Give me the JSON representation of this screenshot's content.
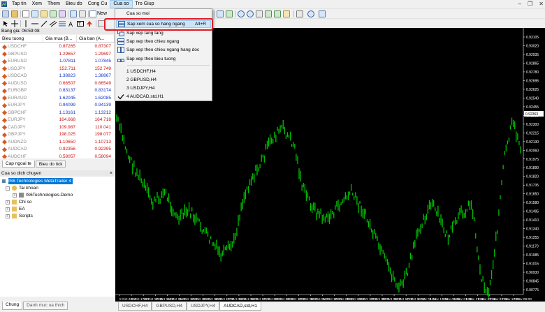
{
  "menubar": {
    "items": [
      "Tap tin",
      "Xem",
      "Them",
      "Bieu do",
      "Cong Cu",
      "Cua so",
      "Tro Giup"
    ],
    "active_index": 5
  },
  "toolbar": {
    "new_order_label": "New"
  },
  "market_watch": {
    "title": "Bang gia: 06:59:08",
    "columns": [
      "Bieu tuong",
      "Gia mua (B...",
      "Gia ban (A..."
    ],
    "rows": [
      {
        "symbol": "USDCHF",
        "bid": "0.87265",
        "ask": "0.87307",
        "color": "#d01010"
      },
      {
        "symbol": "GBPUSD",
        "bid": "1.29657",
        "ask": "1.29697",
        "color": "#d01010"
      },
      {
        "symbol": "EURUSD",
        "bid": "1.07811",
        "ask": "1.07845",
        "color": "#1030c8"
      },
      {
        "symbol": "USDJPY",
        "bid": "152.711",
        "ask": "152.749",
        "color": "#d01010"
      },
      {
        "symbol": "USDCAD",
        "bid": "1.38823",
        "ask": "1.38867",
        "color": "#1030c8"
      },
      {
        "symbol": "AUDUSD",
        "bid": "0.66507",
        "ask": "0.66549",
        "color": "#d01010"
      },
      {
        "symbol": "EURGBP",
        "bid": "0.83137",
        "ask": "0.83174",
        "color": "#1030c8"
      },
      {
        "symbol": "EURAUD",
        "bid": "1.62045",
        "ask": "1.62085",
        "color": "#1030c8"
      },
      {
        "symbol": "EURJPY",
        "bid": "0.94099",
        "ask": "0.94139",
        "color": "#1030c8"
      },
      {
        "symbol": "GBPCHF",
        "bid": "1.13161",
        "ask": "1.13212",
        "color": "#1030c8"
      },
      {
        "symbol": "EURJPY",
        "bid": "164.668",
        "ask": "164.718",
        "color": "#d01010"
      },
      {
        "symbol": "CADJPY",
        "bid": "109.987",
        "ask": "110.041",
        "color": "#d01010"
      },
      {
        "symbol": "GBPJPY",
        "bid": "198.025",
        "ask": "198.077",
        "color": "#d01010"
      },
      {
        "symbol": "AUDNZD",
        "bid": "1.10650",
        "ask": "1.10713",
        "color": "#d01010"
      },
      {
        "symbol": "AUDCAD",
        "bid": "0.92356",
        "ask": "0.92395",
        "color": "#d01010"
      },
      {
        "symbol": "AUDCHF",
        "bid": "0.58057",
        "ask": "0.58094",
        "color": "#d01010"
      }
    ],
    "tabs": [
      "Cap ngoai te",
      "Bieu do tick"
    ],
    "active_tab": 0
  },
  "navigator": {
    "title": "Cua so dich chuyen",
    "close_glyph": "×",
    "items": [
      {
        "label": "IS6 Technologies MetaTrader 4",
        "selected": true
      },
      {
        "label": "Tai khoan"
      },
      {
        "label": "IS6Technologies-Demo"
      },
      {
        "label": "Chi so"
      },
      {
        "label": "EA"
      },
      {
        "label": "Scripts"
      }
    ],
    "tabs": [
      "Chung",
      "Danh muc ua thich"
    ],
    "active_tab": 0
  },
  "dropdown": {
    "items": [
      {
        "label": "Cua so moi",
        "shortcut": "",
        "icon": "none"
      },
      {
        "label": "Sap xem cua so hang ngang",
        "shortcut": "Alt+R",
        "icon": "tile-horizontal-icon",
        "highlighted": true
      },
      {
        "label": "Sap xep tang tang",
        "shortcut": "",
        "icon": "cascade-icon"
      },
      {
        "label": "Sap xep theo chieu ngang",
        "shortcut": "",
        "icon": "tile-horizontal-icon"
      },
      {
        "label": "Sap xep theo chieu ngang hang doc",
        "shortcut": "",
        "icon": "tile-vertical-icon"
      },
      {
        "label": "Sap xep theo bieu tuong",
        "shortcut": "",
        "icon": "arrange-icons-icon"
      },
      {
        "label": "1 USDCHF,H4",
        "shortcut": "",
        "icon": "none"
      },
      {
        "label": "2 GBPUSD,H4",
        "shortcut": "",
        "icon": "none"
      },
      {
        "label": "3 USDJPY,H4",
        "shortcut": "",
        "icon": "none"
      },
      {
        "label": "4 AUDCAD,std,H1",
        "shortcut": "",
        "icon": "check-icon",
        "checked": true
      }
    ]
  },
  "chart": {
    "y_ticks": [
      "0.93105",
      "0.93020",
      "0.92935",
      "0.92865",
      "0.92780",
      "0.92695",
      "0.92625",
      "0.92540",
      "0.92455",
      "0.92385",
      "0.92300",
      "0.92215",
      "0.92130",
      "0.92060",
      "0.91975",
      "0.91890",
      "0.91820",
      "0.91735",
      "0.91650",
      "0.91580",
      "0.91495",
      "0.91410",
      "0.91340",
      "0.91255",
      "0.91170",
      "0.91085",
      "0.91015",
      "0.90930",
      "0.90845",
      "0.90775"
    ],
    "current_price": "0.92363",
    "x_ticks": [
      "8 Oct 2024",
      "9 Oct 17:00",
      "10 Oct 17:00",
      "11 Oct 09:00",
      "14 Oct 01:00",
      "14 Oct 17:00",
      "15 Oct 09:00",
      "16 Oct 01:00",
      "16 Oct 17:00",
      "17 Oct 09:00",
      "18 Oct 01:00",
      "18 Oct 17:00",
      "21 Oct 09:00",
      "22 Oct 01:00",
      "22 Oct 17:00",
      "23 Oct 09:00",
      "24 Oct 01:00",
      "24 Oct 17:00",
      "25 Oct 09:00",
      "28 Oct 01:00",
      "28 Oct 17:00",
      "29 Oct 09:00",
      "30 Oct 01:00",
      "30 Oct 17:00",
      "31 Oct 09:00",
      "1 Nov 01:00",
      "1 Nov 17:00",
      "4 Nov 09:00",
      "5 Nov 01:00",
      "5 Nov 17:00",
      "6 Nov 09:00",
      "7 Nov 01:00",
      "7 Nov 17:00",
      "8 Nov 09:00"
    ],
    "tabs": [
      "USDCHF,H4",
      "GBPUSD,H4",
      "USDJPY,H4",
      "AUDCAD,std,H1"
    ],
    "active_tab": 3,
    "background": "#000000",
    "candle_color": "#00c000",
    "grid_color": "#3a3a3a",
    "price_tag_color": "#ffffff"
  }
}
